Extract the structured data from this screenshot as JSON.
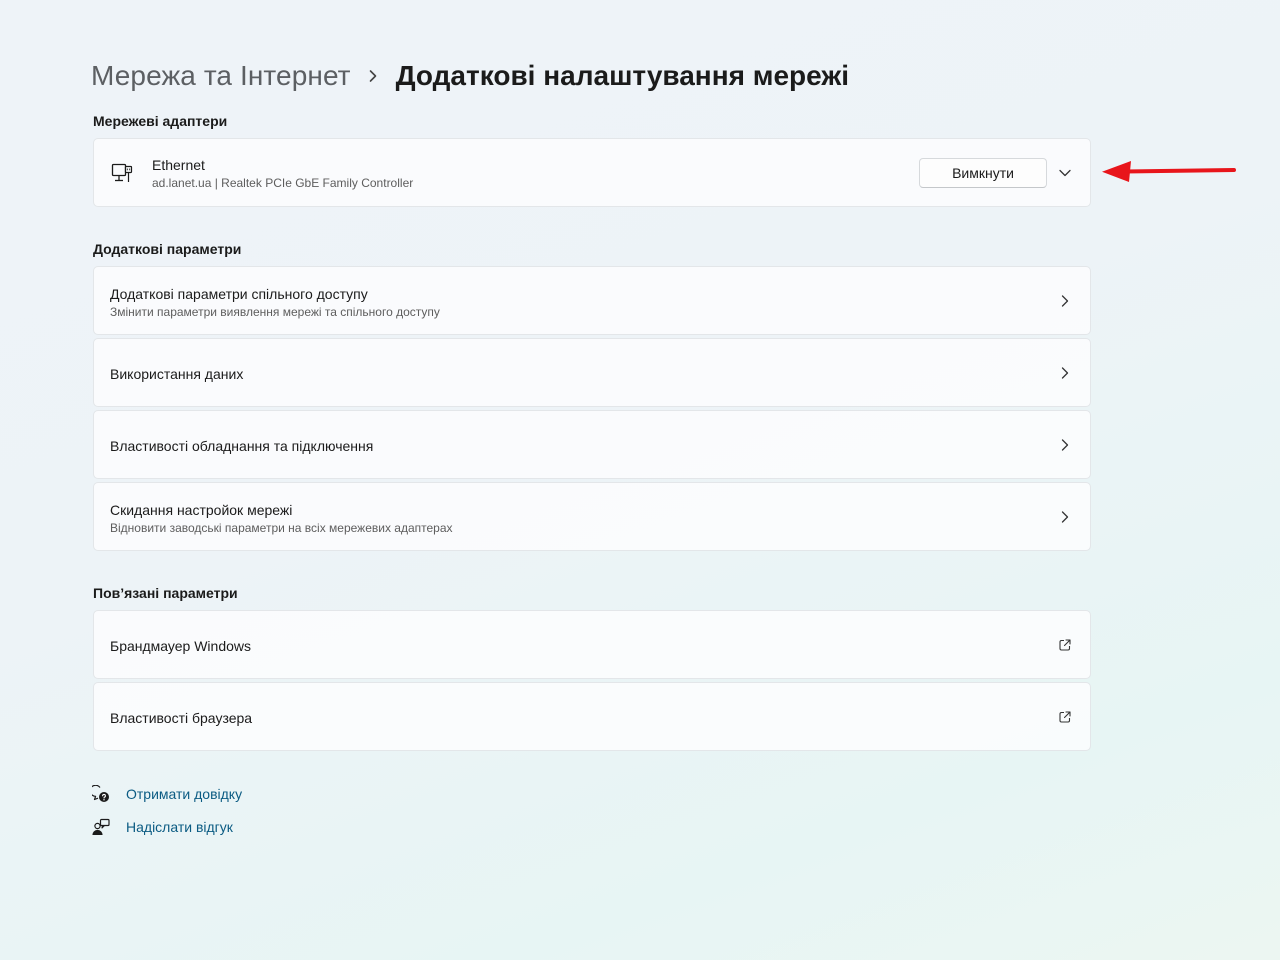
{
  "breadcrumb": {
    "parent": "Мережа та Інтернет",
    "current": "Додаткові налаштування мережі",
    "separator_icon": "chevron-right-icon"
  },
  "adapters": {
    "title": "Мережеві адаптери",
    "items": [
      {
        "name": "Ethernet",
        "description": "ad.lanet.ua | Realtek PCIe GbE Family Controller",
        "action_label": "Вимкнути",
        "icon": "ethernet-computer-icon",
        "expand_icon": "chevron-down-icon"
      }
    ]
  },
  "more_settings": {
    "title": "Додаткові параметри",
    "items": [
      {
        "title": "Додаткові параметри спільного доступу",
        "subtitle": "Змінити параметри виявлення мережі та спільного доступу"
      },
      {
        "title": "Використання даних",
        "subtitle": ""
      },
      {
        "title": "Властивості обладнання та підключення",
        "subtitle": ""
      },
      {
        "title": "Скидання настройок мережі",
        "subtitle": "Відновити заводські параметри на всіх мережевих адаптерах"
      }
    ]
  },
  "related": {
    "title": "Пов’язані параметри",
    "items": [
      {
        "title": "Брандмауер Windows",
        "icon": "open-external-icon"
      },
      {
        "title": "Властивості браузера",
        "icon": "open-external-icon"
      }
    ]
  },
  "footer_links": [
    {
      "label": "Отримати довідку",
      "icon": "help-chat-icon"
    },
    {
      "label": "Надіслати відгук",
      "icon": "feedback-person-icon"
    }
  ],
  "annotation": {
    "icon": "red-arrow-icon",
    "color": "#e8151b"
  },
  "colors": {
    "link": "#0b5b83",
    "text": "#1b1b1b",
    "secondary_text": "#5d5d5d"
  }
}
